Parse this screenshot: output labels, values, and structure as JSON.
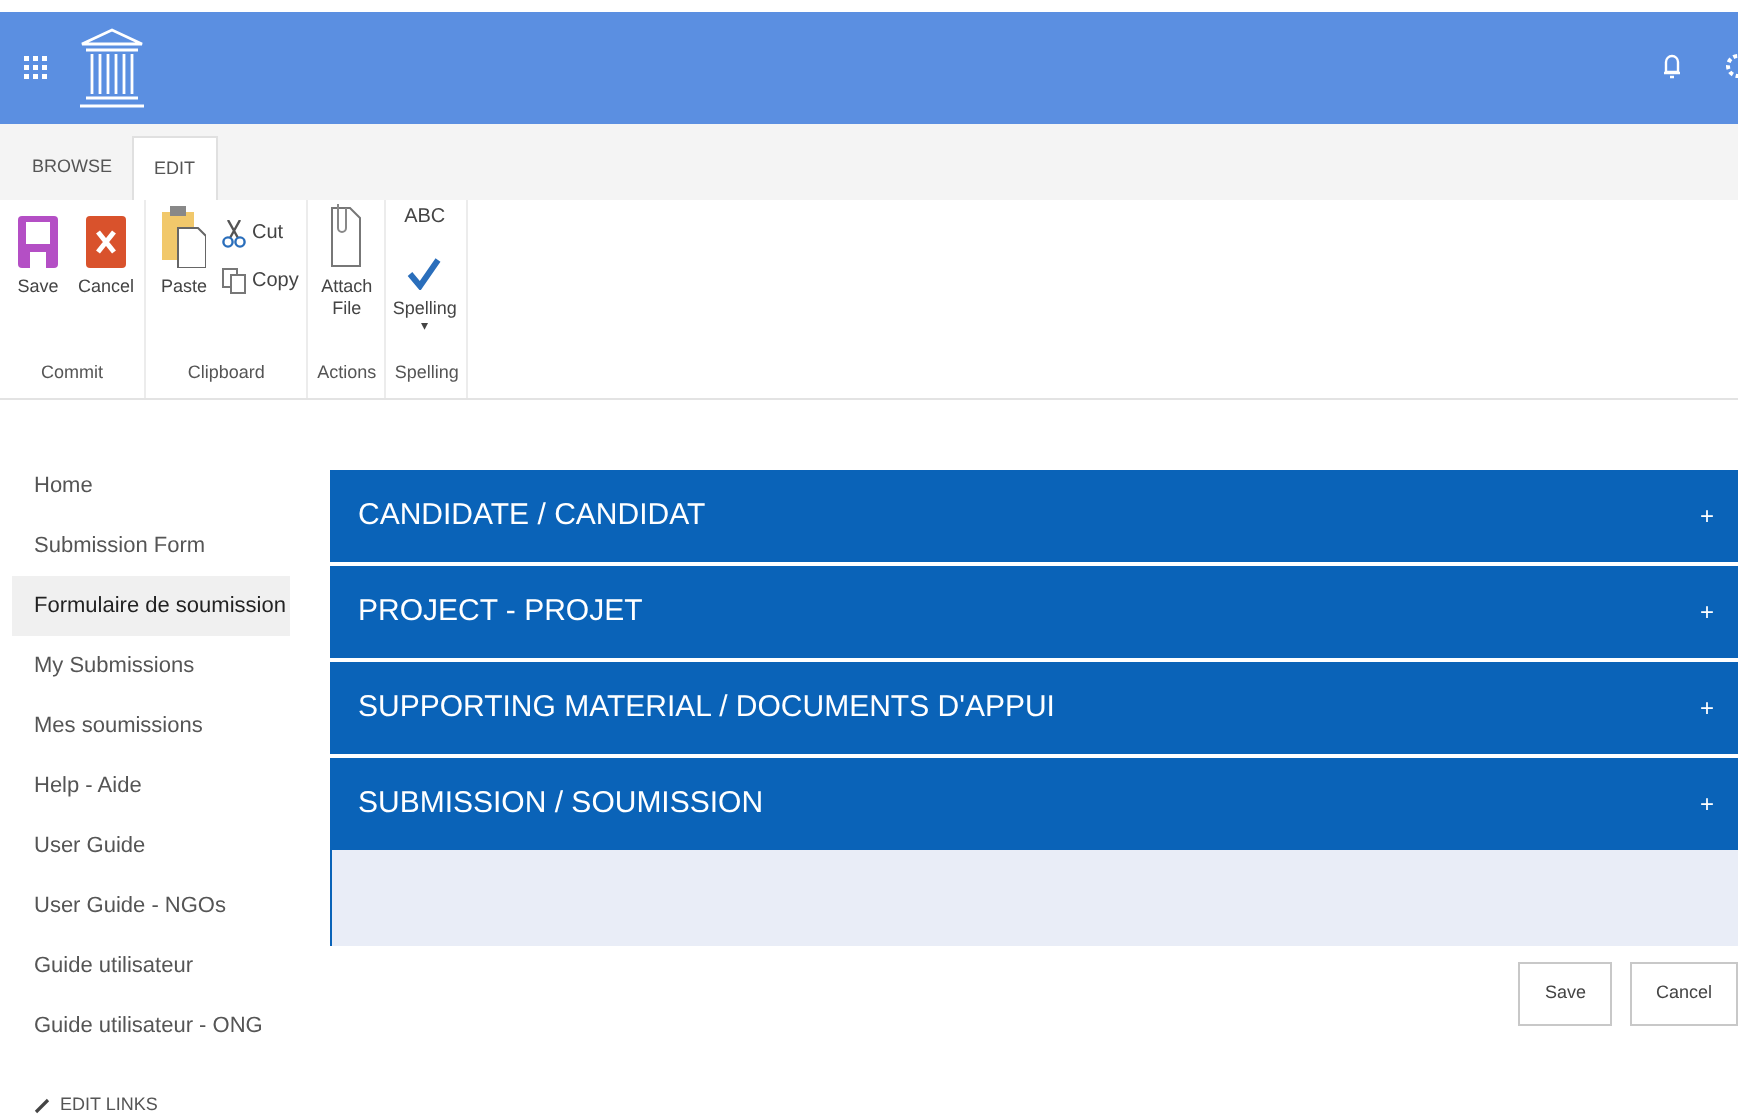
{
  "ribbon_tabs": [
    {
      "label": "BROWSE",
      "selected": false
    },
    {
      "label": "EDIT",
      "selected": true
    }
  ],
  "ribbon_groups": [
    {
      "label": "Commit",
      "buttons": [
        {
          "kind": "save",
          "label": "Save"
        },
        {
          "kind": "cancel",
          "label": "Cancel"
        }
      ]
    },
    {
      "label": "Clipboard",
      "buttons": [
        {
          "kind": "paste",
          "label": "Paste"
        },
        {
          "kind": "cut",
          "label": "Cut"
        },
        {
          "kind": "copy",
          "label": "Copy"
        }
      ]
    },
    {
      "label": "Actions",
      "buttons": [
        {
          "kind": "attach",
          "label": "Attach File"
        }
      ]
    },
    {
      "label": "Spelling",
      "buttons": [
        {
          "kind": "spelling",
          "label": "Spelling",
          "caption": "ABC",
          "caret": "▾"
        }
      ]
    }
  ],
  "nav_items": [
    {
      "label": "Home",
      "selected": false
    },
    {
      "label": "Submission Form",
      "selected": false
    },
    {
      "label": "Formulaire de soumission",
      "selected": true
    },
    {
      "label": "My Submissions",
      "selected": false
    },
    {
      "label": "Mes soumissions",
      "selected": false
    },
    {
      "label": "Help - Aide",
      "selected": false
    },
    {
      "label": "User Guide",
      "selected": false
    },
    {
      "label": "User Guide - NGOs",
      "selected": false
    },
    {
      "label": "Guide utilisateur",
      "selected": false
    },
    {
      "label": "Guide utilisateur - ONG",
      "selected": false
    }
  ],
  "edit_links": "EDIT LINKS",
  "sections": [
    {
      "title": "CANDIDATE / CANDIDAT",
      "toggle": "+"
    },
    {
      "title": "PROJECT - PROJET",
      "toggle": "+"
    },
    {
      "title": "SUPPORTING MATERIAL / DOCUMENTS D'APPUI",
      "toggle": "+"
    },
    {
      "title": "SUBMISSION / SOUMISSION",
      "toggle": "+"
    }
  ],
  "form_buttons": [
    "Save",
    "Cancel"
  ]
}
